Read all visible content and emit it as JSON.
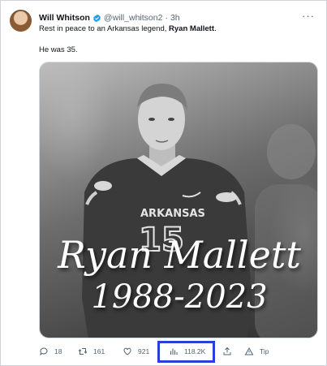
{
  "tweet": {
    "author_name": "Will Whitson",
    "handle": "@will_whitson2",
    "separator": "·",
    "time": "3h",
    "more": "···",
    "text_prefix": "Rest in peace to an Arkansas legend, ",
    "text_bold": "Ryan Mallett",
    "text_suffix": ".",
    "text_line2": "He was 35.",
    "verified_color": "#1d9bf0"
  },
  "media": {
    "overlay_name": "Ryan Mallett",
    "overlay_years": "1988-2023",
    "jersey_text": "ARKANSAS",
    "jersey_number": "15"
  },
  "actions": {
    "replies": "18",
    "retweets": "161",
    "likes": "921",
    "views": "118.2K",
    "tip": "Tip"
  },
  "highlight_color": "#2a3fd8"
}
